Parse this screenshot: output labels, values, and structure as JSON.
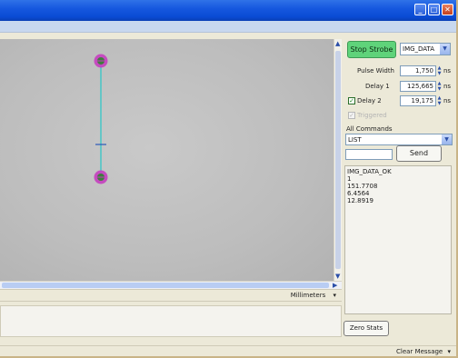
{
  "window": {
    "minimize_glyph": "_",
    "maximize_glyph": "□",
    "close_glyph": "✕"
  },
  "viewport": {
    "units_label": "Millimeters",
    "units_arrow": "▾",
    "line_color": "#3cc7c7",
    "marker_color": "#c53fbf",
    "marker_inner": "#3e7d3e"
  },
  "controls": {
    "strobe_button": "Stop Strobe",
    "mode_select": "IMG_DATA",
    "pulse_width_label": "Pulse Width",
    "pulse_width_value": "1,750",
    "delay1_label": "Delay 1",
    "delay1_value": "125,665",
    "delay2_label": "Delay 2",
    "delay2_value": "19,175",
    "delay2_checked": true,
    "unit_ns": "ns",
    "triggered_label": "Triggered",
    "all_commands_label": "All Commands",
    "command_select": "LIST",
    "command_input": "",
    "send_button": "Send",
    "zero_stats_button": "Zero Stats"
  },
  "output_lines": [
    "IMG_DATA_OK",
    "1",
    "151.7708",
    "6.4564",
    "12.8919"
  ],
  "status": {
    "clear_message": "Clear Message",
    "clear_arrow": "▾"
  },
  "icons": {
    "spin_up": "▲",
    "spin_down": "▼",
    "dropdown": "▼",
    "check": "✓",
    "scroll_up": "▲",
    "scroll_down": "▼",
    "scroll_right": "▶"
  }
}
